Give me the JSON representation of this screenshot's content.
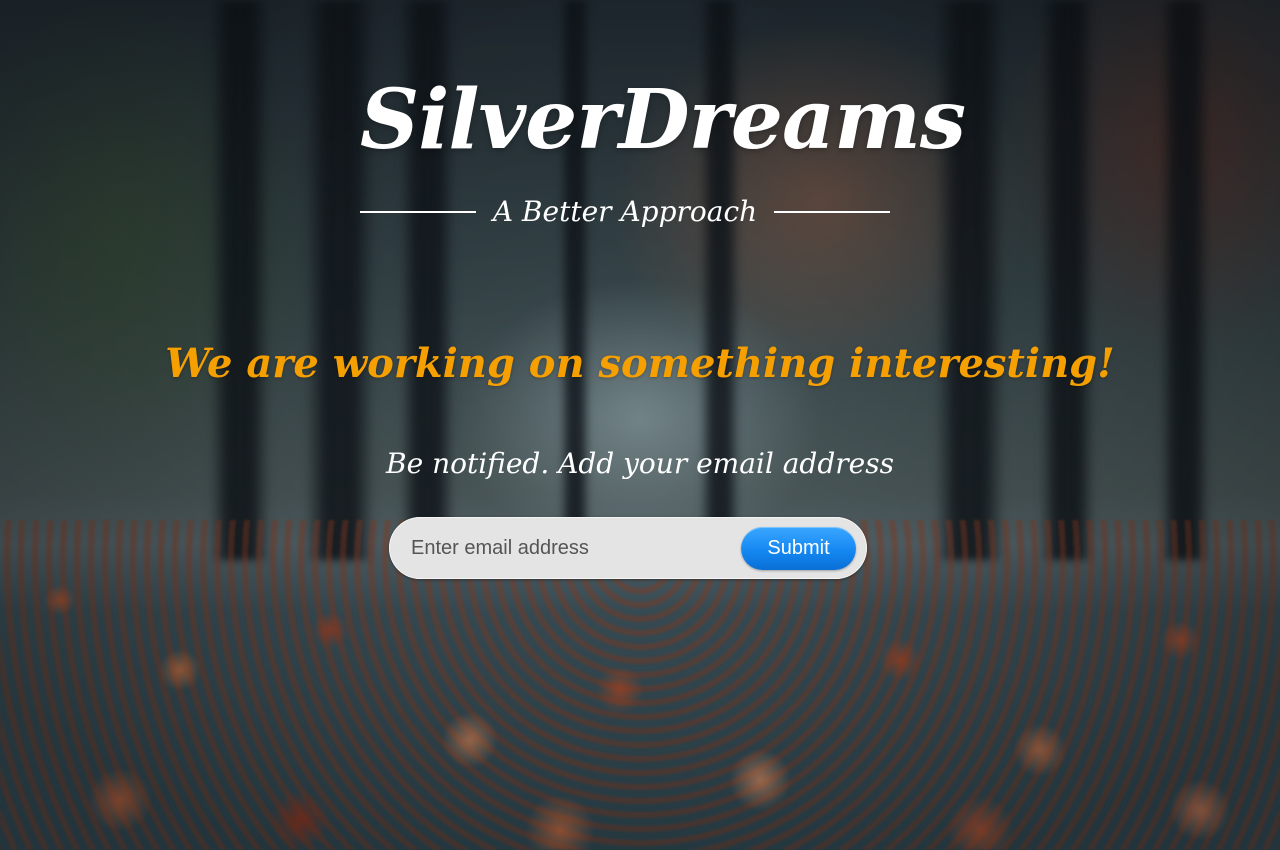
{
  "brand": {
    "logo_text": "SilverDreams",
    "tagline": "A Better Approach"
  },
  "hero": {
    "headline": "We are working on something interesting!",
    "notify_text": "Be notified. Add your email address"
  },
  "signup": {
    "email_placeholder": "Enter email address",
    "submit_label": "Submit"
  },
  "colors": {
    "headline": "#f5a000",
    "button": "#1588f2",
    "input_bg": "#e5e4e4"
  }
}
